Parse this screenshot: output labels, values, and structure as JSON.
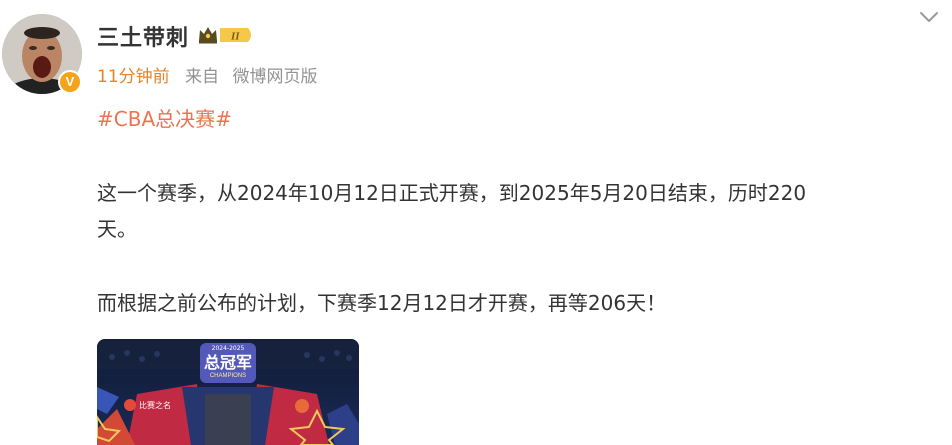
{
  "post": {
    "username": "三土带刺",
    "vip_level": "II",
    "time": "11分钟前",
    "from_label": "来自",
    "source": "微博网页版",
    "topic": "#CBA总决赛#",
    "paragraphs": [
      "这一个赛季，从2024年10月12日正式开赛，到2025年5月20日结束，历时220",
      "天。",
      "而根据之前公布的计划，下赛季12月12日才开赛，再等206天！"
    ],
    "image": {
      "logo_year": "2024-2025",
      "logo_title": "总冠军",
      "logo_sub": "CHAMPIONS",
      "left_team": "比赛之名"
    }
  },
  "colors": {
    "accent_orange": "#e8832a",
    "topic_color": "#eb7350",
    "meta_gray": "#939393",
    "text": "#333333",
    "badge_gold": "#f5a417"
  }
}
